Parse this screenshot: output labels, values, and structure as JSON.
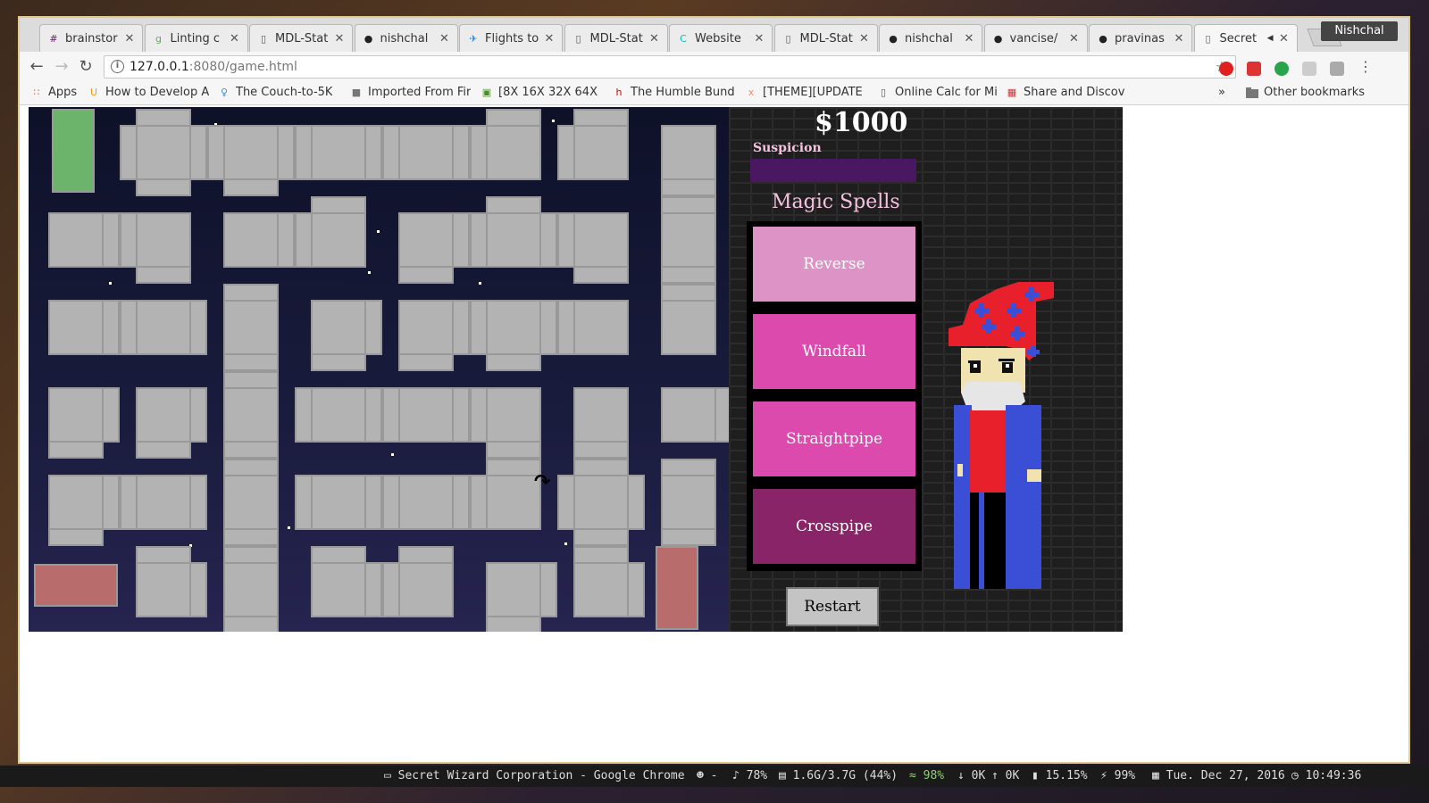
{
  "browser": {
    "tabs": [
      {
        "title": "brainstor",
        "icon": "hash-icon"
      },
      {
        "title": "Linting c",
        "icon": "gjs-icon"
      },
      {
        "title": "MDL-Stat",
        "icon": "doc-icon"
      },
      {
        "title": "nishchal",
        "icon": "github-icon"
      },
      {
        "title": "Flights to",
        "icon": "plane-icon"
      },
      {
        "title": "MDL-Stat",
        "icon": "doc-icon"
      },
      {
        "title": "Website",
        "icon": "c-icon"
      },
      {
        "title": "MDL-Stat",
        "icon": "doc-icon"
      },
      {
        "title": "nishchal",
        "icon": "github-icon"
      },
      {
        "title": "vancise/",
        "icon": "github-icon"
      },
      {
        "title": "pravinas",
        "icon": "github-icon"
      },
      {
        "title": "Secret",
        "icon": "doc-icon",
        "active": true
      }
    ],
    "profile": "Nishchal",
    "url_host": "127.0.0.1",
    "url_rest": ":8080/game.html",
    "info_glyph": "i",
    "bookmarks": [
      {
        "label": "Apps",
        "icon": "apps-icon"
      },
      {
        "label": "How to Develop A",
        "icon": "udacity-icon"
      },
      {
        "label": "The Couch-to-5K",
        "icon": "runner-icon"
      },
      {
        "label": "Imported From Fir",
        "icon": "folder-icon"
      },
      {
        "label": "[8X 16X 32X 64X",
        "icon": "cube-icon"
      },
      {
        "label": "The Humble Bund",
        "icon": "humble-icon"
      },
      {
        "label": "[THEME][UPDATE",
        "icon": "xda-icon"
      },
      {
        "label": "Online Calc for Mi",
        "icon": "doc-icon"
      },
      {
        "label": "Share and Discov",
        "icon": "grid-icon"
      }
    ],
    "more_bookmarks": "»",
    "other_bookmarks": "Other bookmarks"
  },
  "game": {
    "money": "$1000",
    "suspicion_label": "Suspicion",
    "suspicion_level": 1.0,
    "spells_title": "Magic Spells",
    "spells": [
      {
        "label": "Reverse",
        "color": "#de93c6"
      },
      {
        "label": "Windfall",
        "color": "#dc4aae"
      },
      {
        "label": "Straightpipe",
        "color": "#dc4aae"
      },
      {
        "label": "Crosspipe",
        "color": "#8a2468"
      }
    ],
    "restart_label": "Restart",
    "pipe_color": "#b3b3b3",
    "start_pipe_color": "#6cb46c",
    "end_pipe_color": "#b86c6c"
  },
  "statusbar": {
    "window_title": "Secret Wizard Corporation - Google Chrome",
    "player": "-",
    "volume": "78%",
    "memory": "1.6G/3.7G (44%)",
    "wifi": "98%",
    "net_down": "0K",
    "net_up": "0K",
    "cpu": "15.15%",
    "battery": "99%",
    "date": "Tue. Dec 27, 2016",
    "time": "10:49:36"
  }
}
